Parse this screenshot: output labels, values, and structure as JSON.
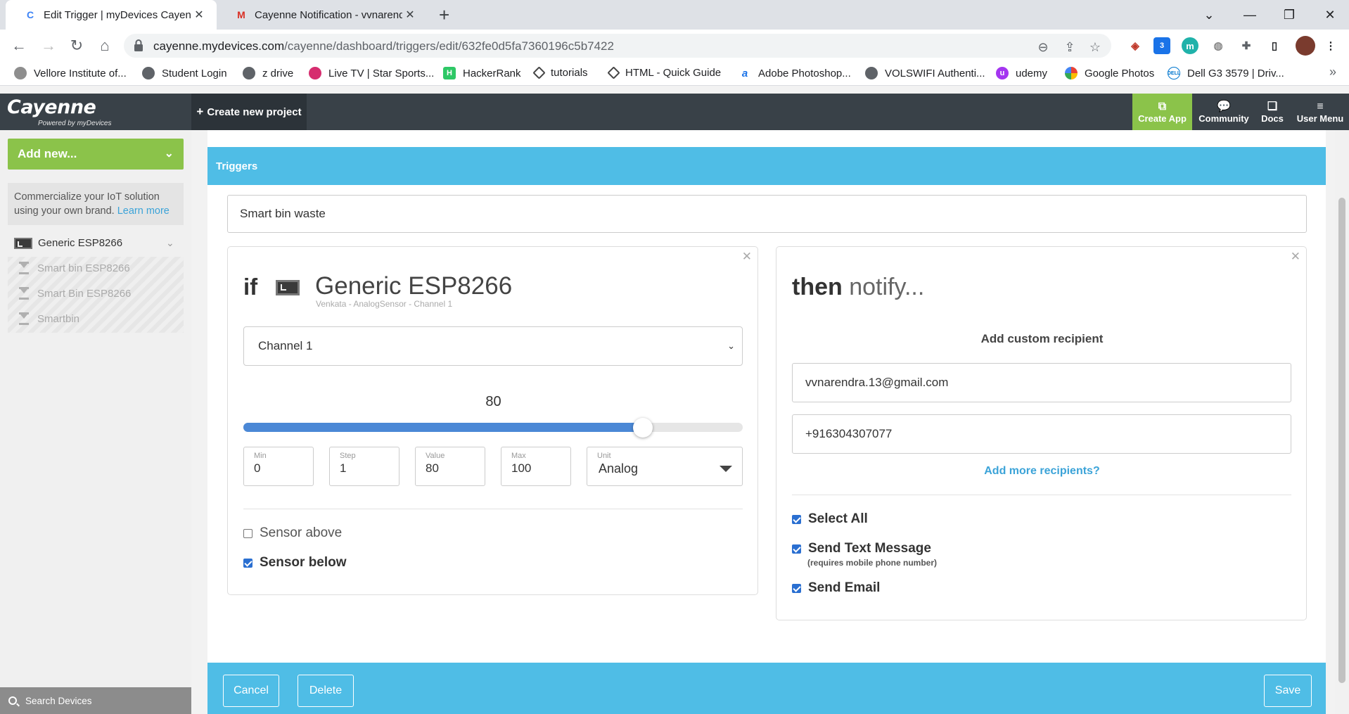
{
  "browser": {
    "tabs": [
      {
        "title": "Edit Trigger | myDevices Cayenne",
        "active": true
      },
      {
        "title": "Cayenne Notification - vvnarendr",
        "active": false
      }
    ],
    "url_domain": "cayenne.mydevices.com",
    "url_path": "/cayenne/dashboard/triggers/edit/632fe0d5fa7360196c5b7422",
    "extension_badge": "3",
    "bookmarks": [
      "Vellore Institute of...",
      "Student Login",
      "z drive",
      "Live TV | Star Sports...",
      "HackerRank",
      "tutorials",
      "HTML - Quick Guide",
      "Adobe Photoshop...",
      "VOLSWIFI Authenti...",
      "udemy",
      "Google Photos",
      "Dell G3 3579 | Driv..."
    ]
  },
  "app": {
    "logo": "Cayenne",
    "logo_sub": "Powered by myDevices",
    "create_project": "Create new project",
    "header_items": [
      "Create App",
      "Community",
      "Docs",
      "User Menu"
    ]
  },
  "sidebar": {
    "add_new": "Add new...",
    "promo_text": "Commercialize your IoT solution using your own brand.",
    "promo_link": "Learn more",
    "device": "Generic ESP8266",
    "sub_devices": [
      "Smart bin ESP8266",
      "Smart Bin ESP8266",
      "Smartbin"
    ],
    "search": "Search Devices"
  },
  "trigger": {
    "section_title": "Triggers",
    "name": "Smart bin waste",
    "if_word": "if",
    "device_name": "Generic ESP8266",
    "device_sub": "Venkata -  AnalogSensor -  Channel 1",
    "channel": "Channel 1",
    "slider_value": "80",
    "slider_fraction": 0.8,
    "fields": {
      "min_label": "Min",
      "min": "0",
      "step_label": "Step",
      "step": "1",
      "value_label": "Value",
      "value": "80",
      "max_label": "Max",
      "max": "100",
      "unit_label": "Unit",
      "unit": "Analog"
    },
    "sensor_above": "Sensor above",
    "sensor_below": "Sensor below",
    "sensor_above_checked": false,
    "sensor_below_checked": true
  },
  "notify": {
    "then": "then",
    "notify": "notify...",
    "add_custom": "Add custom recipient",
    "email": "vvnarendra.13@gmail.com",
    "phone": "+916304307077",
    "add_more": "Add more recipients?",
    "select_all": "Select All",
    "send_text": "Send Text Message",
    "send_text_note": "(requires mobile phone number)",
    "send_email": "Send Email"
  },
  "footer": {
    "cancel": "Cancel",
    "delete": "Delete",
    "save": "Save"
  },
  "colors": {
    "accent_blue": "#4fbde6",
    "accent_green": "#8bc34a",
    "header_dark": "#394148",
    "slider_blue": "#4b88d6"
  }
}
